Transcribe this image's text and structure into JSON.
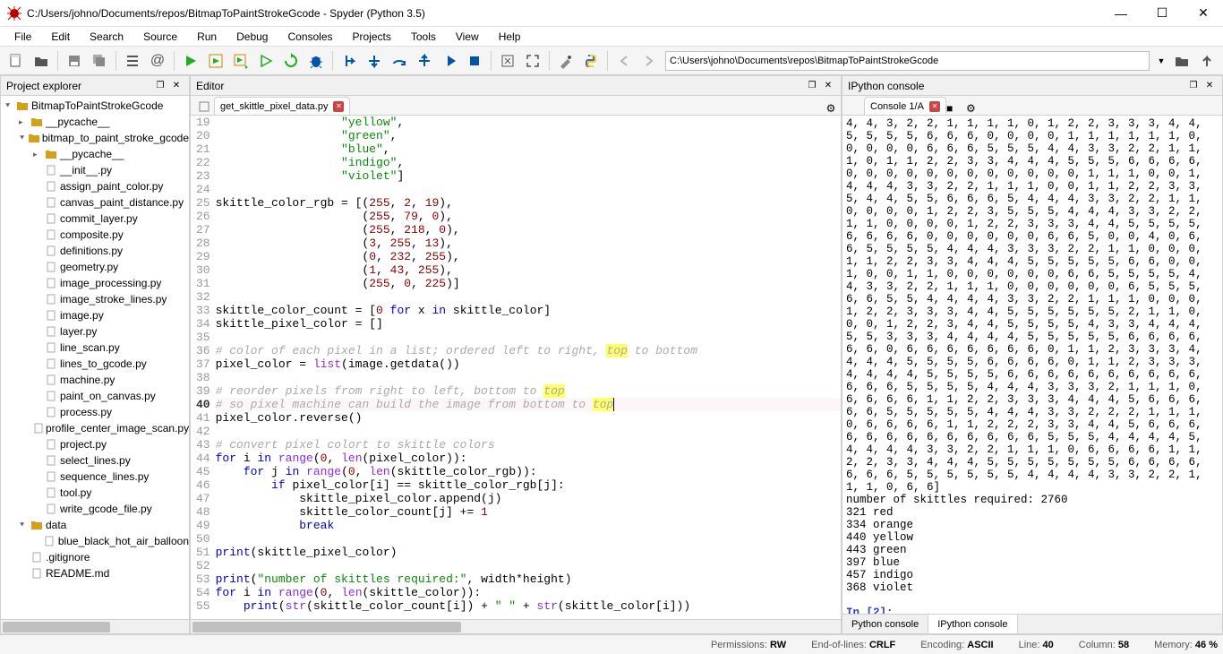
{
  "title": "C:/Users/johno/Documents/repos/BitmapToPaintStrokeGcode - Spyder (Python 3.5)",
  "menus": [
    "File",
    "Edit",
    "Search",
    "Source",
    "Run",
    "Debug",
    "Consoles",
    "Projects",
    "Tools",
    "View",
    "Help"
  ],
  "path_field": "C:\\Users\\johno\\Documents\\repos\\BitmapToPaintStrokeGcode",
  "project_explorer": {
    "title": "Project explorer"
  },
  "tree": {
    "root": "BitmapToPaintStrokeGcode",
    "folders_l1": [
      "__pycache__",
      "bitmap_to_paint_stroke_gcode"
    ],
    "folders_l2": [
      "__pycache__"
    ],
    "files_l2": [
      "__init__.py",
      "assign_paint_color.py",
      "canvas_paint_distance.py",
      "commit_layer.py",
      "composite.py",
      "definitions.py",
      "geometry.py",
      "image_processing.py",
      "image_stroke_lines.py",
      "image.py",
      "layer.py",
      "line_scan.py",
      "lines_to_gcode.py",
      "machine.py",
      "paint_on_canvas.py",
      "process.py",
      "profile_center_image_scan.py",
      "project.py",
      "select_lines.py",
      "sequence_lines.py",
      "tool.py",
      "write_gcode_file.py"
    ],
    "folder_data": "data",
    "files_data": [
      "blue_black_hot_air_balloon"
    ],
    "files_root": [
      ".gitignore",
      "README.md"
    ]
  },
  "editor": {
    "title": "Editor",
    "tab": "get_skittle_pixel_data.py",
    "first_line_no": 19,
    "current_line_index": 21
  },
  "console": {
    "title": "IPython console",
    "tab": "Console 1/A",
    "numbers": "4, 4, 3, 2, 2, 1, 1, 1, 1, 0, 1, 2, 2, 3, 3, 3, 4, 4, 5, 5, 5, 5, 6, 6, 6, 0, 0, 0, 0, 1, 1, 1, 1, 1, 1, 0, 0, 0, 0, 0, 6, 6, 6, 5, 5, 5, 4, 4, 3, 3, 2, 2, 1, 1, 1, 0, 1, 1, 2, 2, 3, 3, 4, 4, 4, 5, 5, 5, 6, 6, 6, 6, 0, 0, 0, 0, 0, 0, 0, 0, 0, 0, 0, 0, 1, 1, 1, 0, 0, 1, 4, 4, 4, 3, 3, 2, 2, 1, 1, 1, 0, 0, 1, 1, 2, 2, 3, 3, 5, 4, 4, 5, 5, 6, 6, 6, 5, 4, 4, 4, 3, 3, 2, 2, 1, 1, 0, 0, 0, 0, 1, 2, 2, 3, 5, 5, 5, 4, 4, 4, 3, 3, 2, 2, 1, 1, 0, 0, 0, 0, 1, 2, 2, 3, 3, 3, 4, 4, 5, 5, 5, 5, 6, 6, 6, 6, 0, 0, 0, 0, 0, 0, 6, 6, 5, 0, 0, 4, 0, 6, 6, 5, 5, 5, 5, 4, 4, 4, 3, 3, 3, 2, 2, 1, 1, 0, 0, 0, 1, 1, 2, 2, 3, 3, 4, 4, 4, 5, 5, 5, 5, 5, 6, 6, 0, 0, 1, 0, 0, 1, 1, 0, 0, 0, 0, 0, 0, 6, 6, 5, 5, 5, 5, 4, 4, 3, 3, 2, 2, 1, 1, 1, 0, 0, 0, 0, 0, 0, 6, 5, 5, 5, 6, 6, 5, 5, 4, 4, 4, 4, 3, 3, 2, 2, 1, 1, 1, 0, 0, 0, 1, 2, 2, 3, 3, 3, 4, 4, 5, 5, 5, 5, 5, 5, 2, 1, 1, 0, 0, 0, 1, 2, 2, 3, 4, 4, 5, 5, 5, 5, 4, 3, 3, 4, 4, 4, 5, 5, 3, 3, 3, 4, 4, 4, 4, 5, 5, 5, 5, 5, 6, 6, 6, 6, 6, 6, 0, 6, 6, 6, 6, 6, 6, 6, 0, 1, 1, 2, 3, 3, 3, 4, 4, 4, 4, 5, 5, 5, 5, 6, 6, 6, 6, 0, 1, 1, 2, 3, 3, 3, 4, 4, 4, 4, 5, 5, 5, 5, 6, 6, 6, 6, 6, 6, 6, 6, 6, 6, 6, 6, 6, 5, 5, 5, 5, 4, 4, 4, 3, 3, 3, 2, 1, 1, 1, 0, 6, 6, 6, 6, 1, 1, 2, 2, 3, 3, 3, 4, 4, 4, 5, 6, 6, 6, 6, 6, 5, 5, 5, 5, 5, 4, 4, 4, 3, 3, 2, 2, 2, 1, 1, 1, 0, 6, 6, 6, 6, 1, 1, 2, 2, 2, 3, 3, 4, 4, 5, 6, 6, 6, 6, 6, 6, 6, 6, 6, 6, 6, 6, 6, 5, 5, 5, 4, 4, 4, 4, 5, 4, 4, 4, 4, 3, 3, 2, 2, 1, 1, 1, 0, 6, 6, 6, 6, 1, 1, 2, 2, 3, 3, 4, 4, 4, 5, 5, 5, 5, 5, 5, 5, 6, 6, 6, 6, 6, 6, 6, 5, 5, 5, 5, 5, 5, 4, 4, 4, 4, 3, 3, 2, 2, 1, 1, 1, 0, 6, 6]",
    "summary_label": "number of skittles required:",
    "summary_value": "2760",
    "counts": [
      {
        "n": "321",
        "c": "red"
      },
      {
        "n": "334",
        "c": "orange"
      },
      {
        "n": "440",
        "c": "yellow"
      },
      {
        "n": "443",
        "c": "green"
      },
      {
        "n": "397",
        "c": "blue"
      },
      {
        "n": "457",
        "c": "indigo"
      },
      {
        "n": "368",
        "c": "violet"
      }
    ],
    "prompt": "In [2]:",
    "bottom_tabs": [
      "Python console",
      "IPython console"
    ]
  },
  "status": {
    "perm_label": "Permissions:",
    "perm": "RW",
    "eol_label": "End-of-lines:",
    "eol": "CRLF",
    "enc_label": "Encoding:",
    "enc": "ASCII",
    "line_label": "Line:",
    "line": "40",
    "col_label": "Column:",
    "col": "58",
    "mem_label": "Memory:",
    "mem": "46 %"
  }
}
